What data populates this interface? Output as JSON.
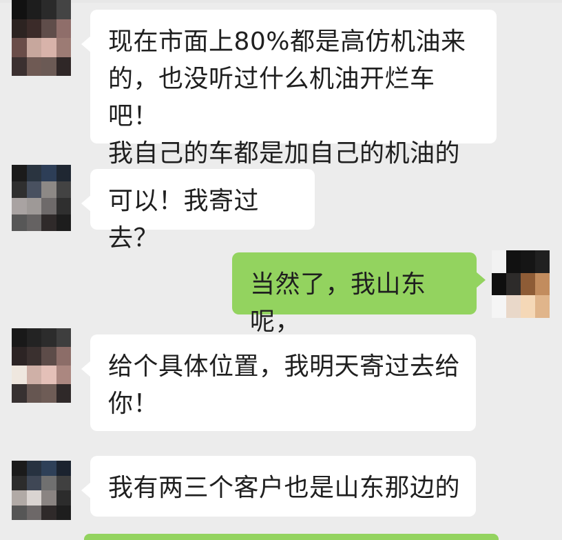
{
  "messages": [
    {
      "side": "left",
      "text": "现在市面上80%都是高仿机油来\n的，也没听过什么机油开烂车吧！\n我自己的车都是加自己的机油的"
    },
    {
      "side": "left",
      "text": "可以！我寄过去？"
    },
    {
      "side": "right",
      "text": "当然了，我山东呢，"
    },
    {
      "side": "left",
      "text": "给个具体位置，我明天寄过去给\n你！"
    },
    {
      "side": "left",
      "text": "我有两三个客户也是山东那边的"
    }
  ],
  "colors": {
    "background": "#ececec",
    "incoming_bubble": "#ffffff",
    "outgoing_bubble": "#93d35f",
    "text": "#1f1f1f"
  }
}
